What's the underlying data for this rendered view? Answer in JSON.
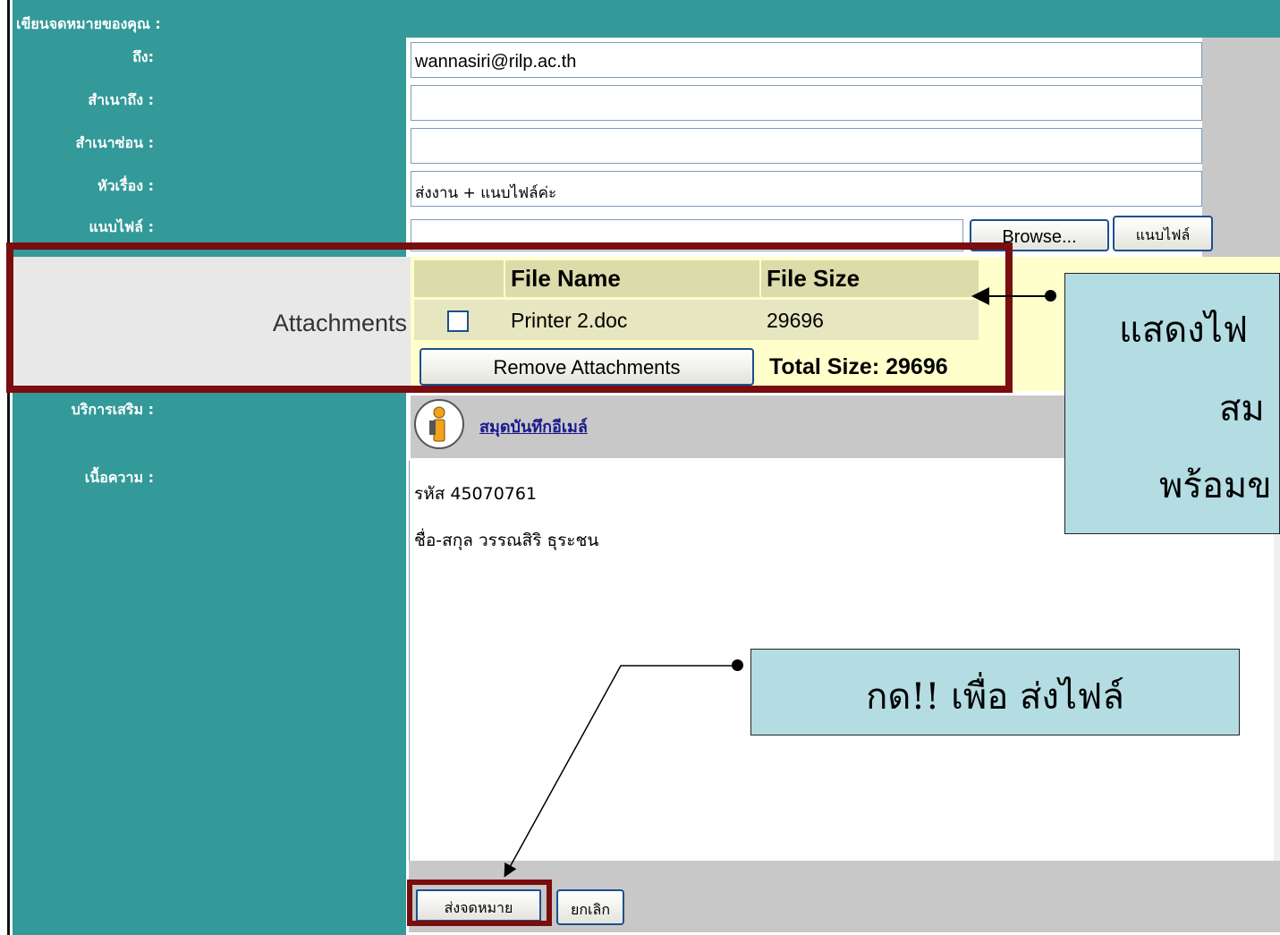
{
  "header": {
    "title": "เขียนจดหมายของคุณ :"
  },
  "form": {
    "to_label": "ถึง:",
    "to_value": "wannasiri@rilp.ac.th",
    "cc_label": "สำเนาถึง :",
    "cc_value": "",
    "bcc_label": "สำเนาซ่อน :",
    "bcc_value": "",
    "subject_label": "หัวเรื่อง :",
    "subject_value": "ส่งงาน + แนบไฟล์ค่ะ",
    "attach_label": "แนบไฟล์ :",
    "browse_label": "Browse...",
    "attach_button_label": "แนบไฟล์",
    "services_label": "บริการเสริม :",
    "addressbook_link": "สมุดบันทึกอีเมล์",
    "body_label": "เนื้อความ :",
    "body_lines": [
      "รหัส 45070761",
      "ชื่อ-สกุล วรรณสิริ ธุระชน"
    ]
  },
  "attachments": {
    "label": "Attachments",
    "headers": {
      "name": "File Name",
      "size": "File Size"
    },
    "rows": [
      {
        "checked": false,
        "name": "Printer 2.doc",
        "size": "29696"
      }
    ],
    "remove_button": "Remove Attachments",
    "total": "Total Size: 29696"
  },
  "footer": {
    "send_button": "ส่งจดหมาย",
    "cancel_button": "ยกเลิก"
  },
  "callouts": {
    "attach_callout_lines": [
      "แสดงไฟ",
      "สม",
      "พร้อมข"
    ],
    "send_callout": "กด!! เพื่อ ส่งไฟล์"
  },
  "colors": {
    "sidebar": "#339999",
    "highlight_box": "#7a0d0d",
    "callout_bg": "#b3dde3",
    "attachment_panel": "#ffffcc",
    "table_header": "#dcdcaa"
  },
  "icons": {
    "addressbook": "person-info-icon",
    "checkbox": "checkbox-icon"
  }
}
